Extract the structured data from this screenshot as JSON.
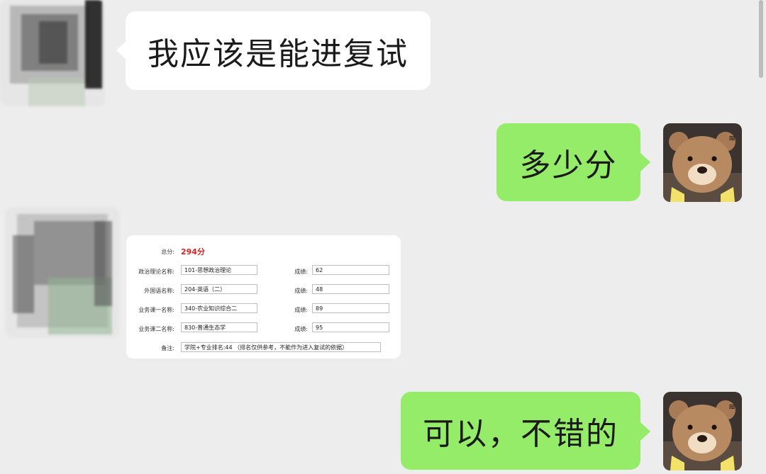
{
  "messages": [
    {
      "side": "left",
      "type": "text",
      "text": "我应该是能进复试"
    },
    {
      "side": "right",
      "type": "text",
      "text": "多少分"
    },
    {
      "side": "left",
      "type": "image"
    },
    {
      "side": "right",
      "type": "text",
      "text": "可以，不错的"
    }
  ],
  "scorecard": {
    "total_label": "总分:",
    "total_value": "294分",
    "rows": [
      {
        "label": "政治理论名称:",
        "subject": "101-思想政治理论",
        "score_label": "成绩:",
        "score": "62"
      },
      {
        "label": "外国语名称:",
        "subject": "204-英语（二）",
        "score_label": "成绩:",
        "score": "48"
      },
      {
        "label": "业务课一名称:",
        "subject": "340-农业知识综合二",
        "score_label": "成绩:",
        "score": "89"
      },
      {
        "label": "业务课二名称:",
        "subject": "830-普通生态学",
        "score_label": "成绩:",
        "score": "95"
      }
    ],
    "note_label": "备注:",
    "note_value": "学院+专业排名:44 （排名仅供参考，不能作为进入复试的依据）"
  },
  "colors": {
    "background": "#ededed",
    "bubble_self": "#95ec69",
    "bubble_other": "#ffffff",
    "total_score": "#e02020"
  },
  "icons": {
    "self_avatar": "teddy-bear-avatar",
    "other_avatar": "blurred-avatar"
  }
}
